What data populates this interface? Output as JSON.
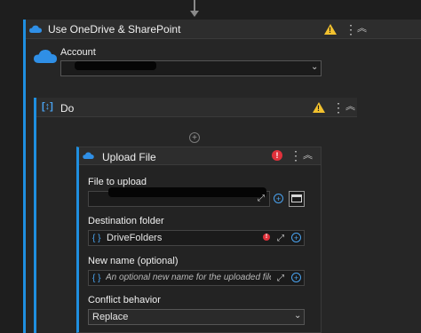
{
  "outer_action": {
    "title": "Use OneDrive & SharePoint",
    "account_label": "Account"
  },
  "do_block": {
    "title": "Do"
  },
  "upload_action": {
    "title": "Upload File",
    "file_to_upload_label": "File to upload",
    "destination_folder_label": "Destination folder",
    "destination_folder_value": "DriveFolders",
    "new_name_label": "New name (optional)",
    "new_name_placeholder": "An optional new name for the uploaded file",
    "conflict_behavior_label": "Conflict behavior",
    "conflict_behavior_value": "Replace"
  },
  "icons": {
    "warning": "warning-triangle-icon",
    "error": "error-circle-icon",
    "more": "kebab-icon",
    "collapse": "collapse-chevrons-icon",
    "cloud": "onedrive-cloud-icon",
    "expand": "expand-icon",
    "add": "add-circle-icon",
    "folder": "folder-icon"
  },
  "colors": {
    "accent": "#1f8fe0",
    "warning": "#f2c12e",
    "error": "#e0313b"
  }
}
